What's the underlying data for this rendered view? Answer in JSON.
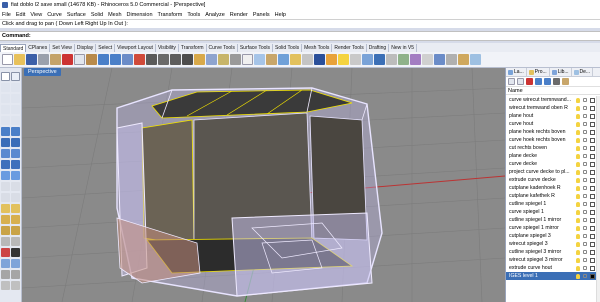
{
  "window": {
    "title": "fiat doblo l2 save small (14678 KB) - Rhinoceros 5.0 Commercial - [Perspective]"
  },
  "menu": [
    "File",
    "Edit",
    "View",
    "Curve",
    "Surface",
    "Solid",
    "Mesh",
    "Dimension",
    "Transform",
    "Tools",
    "Analyze",
    "Render",
    "Panels",
    "Help"
  ],
  "command": {
    "history": "Click and drag to pan ( Down  Left  Right  Up  In  Out ):",
    "prompt": "Command:",
    "value": ""
  },
  "toolbar_tabs": [
    "Standard",
    "CPlanes",
    "Set View",
    "Display",
    "Select",
    "Viewport Layout",
    "Visibility",
    "Transform",
    "Curve Tools",
    "Surface Tools",
    "Solid Tools",
    "Mesh Tools",
    "Render Tools",
    "Drafting",
    "New in V5"
  ],
  "viewport": {
    "label": "Perspective"
  },
  "panel": {
    "tabs": [
      "La...",
      "Pro...",
      "Lib...",
      "De..."
    ],
    "column_header": "Name",
    "layers": [
      "curve wirecut tremnwand...",
      "wirecut tremwand oben R",
      "plane hout",
      "curve hout",
      "plane hoek rechts boven",
      "curve hoek rechts boven",
      "cut rechts boven",
      "plane decke",
      "curve decke",
      "project curve decke to pl...",
      "extrude curve decke",
      "cutplane kadenhoek R",
      "cutplane kafethek R",
      "cutline spiegel 1",
      "curve spiegel 1",
      "cutline spiegel 1 mirror",
      "curve spiegel 1 mirror",
      "cutplane spiegel 3",
      "wirecut spiegel 3",
      "cutline spiegel 3 mirror",
      "wirecut spiegel 3 mirror",
      "extrude curve hout",
      "IGES level 1"
    ],
    "selected_index": 22
  },
  "colors": {
    "accent": "#3b6fb6",
    "wire": "#c8c0f0",
    "highlight": "#f2e200",
    "viewport_bg": "#8a8a8a"
  }
}
